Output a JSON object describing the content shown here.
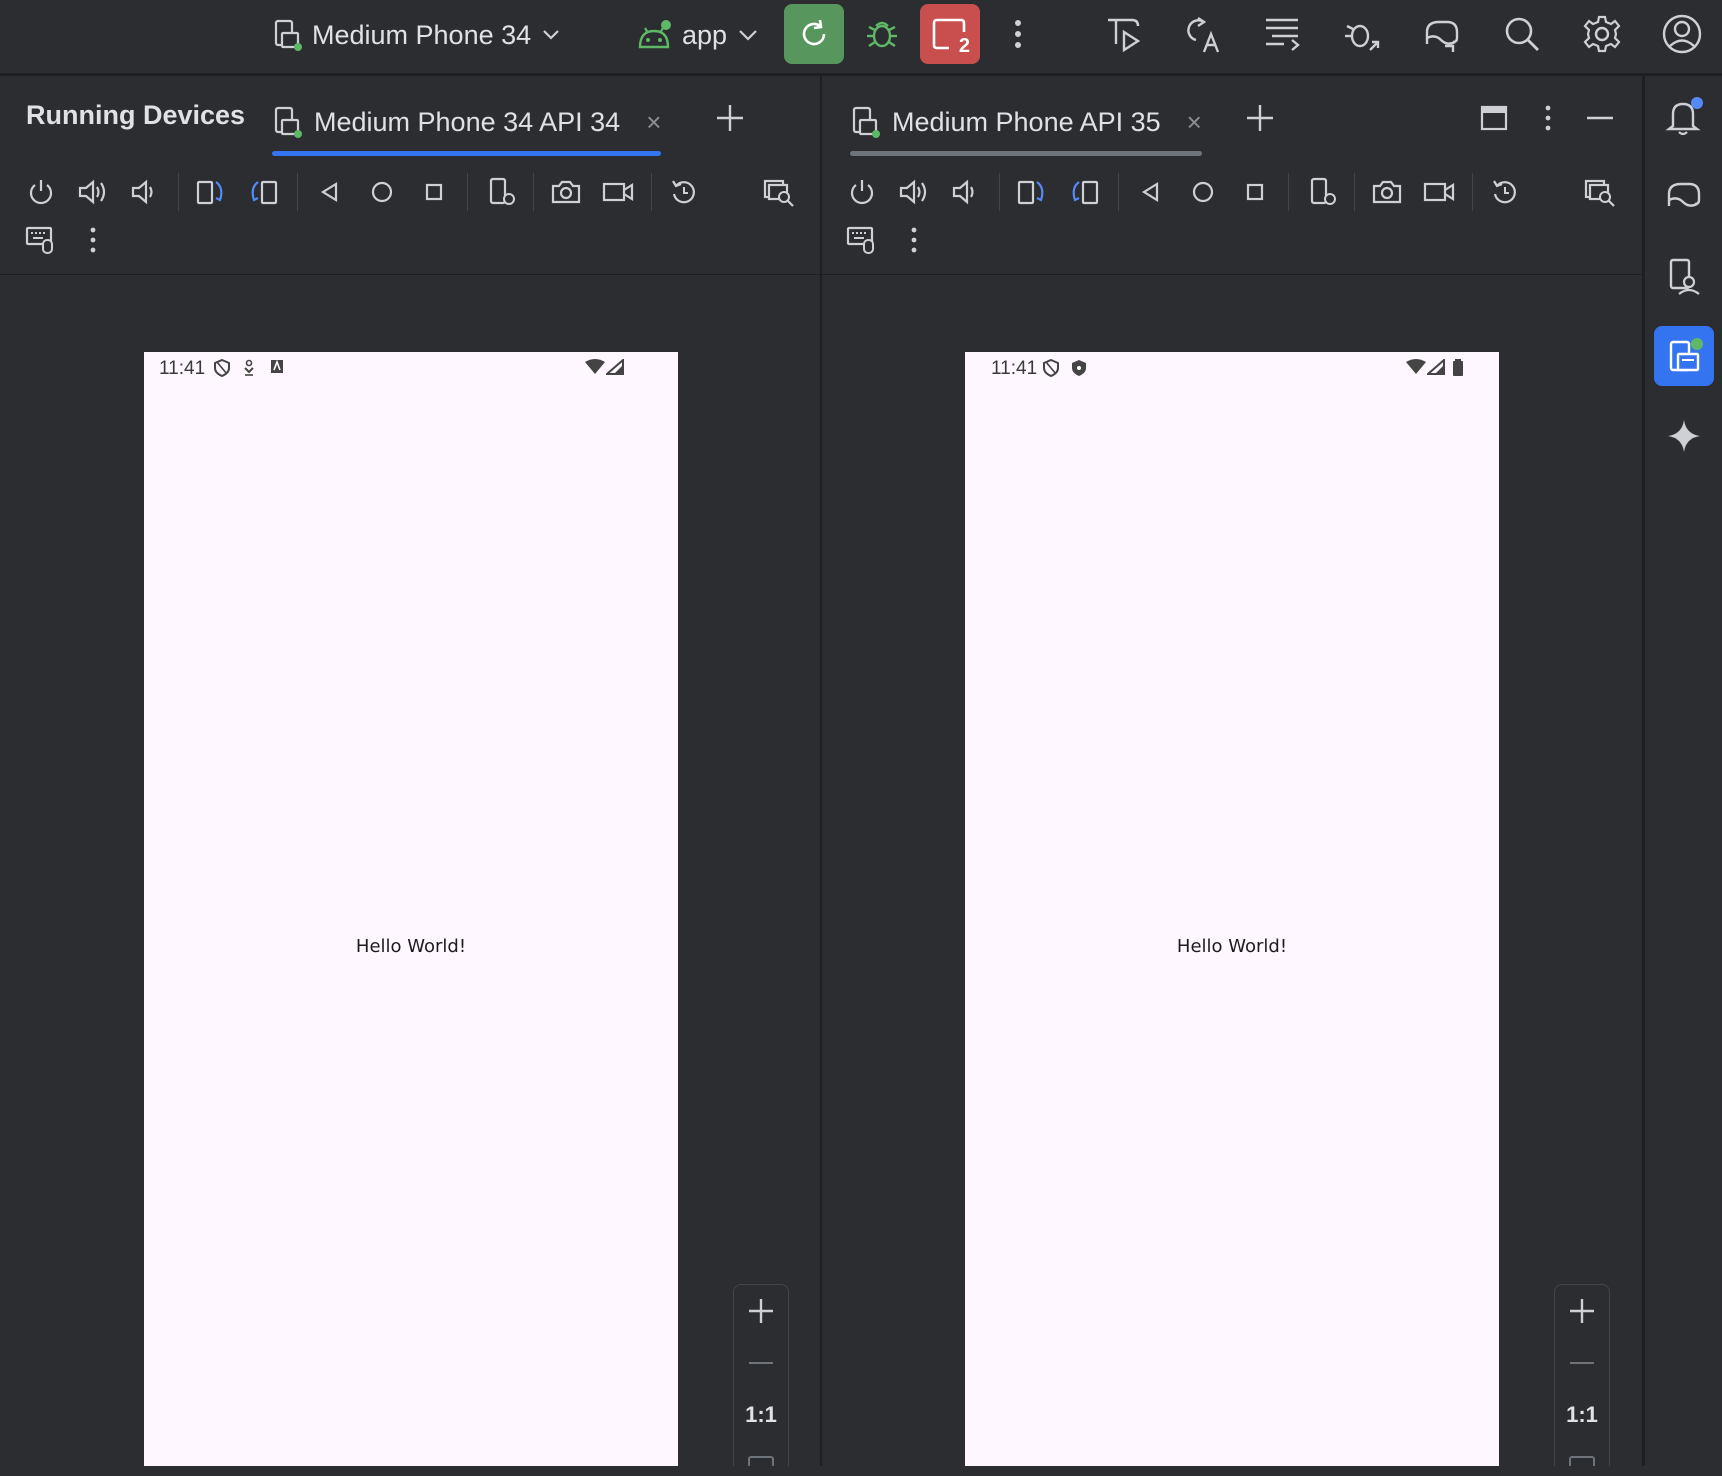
{
  "toolbar": {
    "device_selector": "Medium Phone 34",
    "app_selector": "app",
    "stop_badge": "2",
    "colors": {
      "rerun_bg": "#57965c",
      "stop_bg": "#c94f4f",
      "debug": "#5fb865"
    }
  },
  "running_devices": {
    "title": "Running Devices",
    "tabs": [
      {
        "label": "Medium Phone 34 API 34",
        "close": "×",
        "active": true
      },
      {
        "label": "Medium Phone API 35",
        "close": "×",
        "active": false
      }
    ]
  },
  "devices": [
    {
      "status_time": "11:41",
      "content_text": "Hello World!",
      "zoom": {
        "in": "+",
        "out": "—",
        "ratio": "1:1"
      }
    },
    {
      "status_time": "11:41",
      "content_text": "Hello World!",
      "zoom": {
        "in": "+",
        "out": "—",
        "ratio": "1:1"
      }
    }
  ],
  "accent": "#3574f0"
}
